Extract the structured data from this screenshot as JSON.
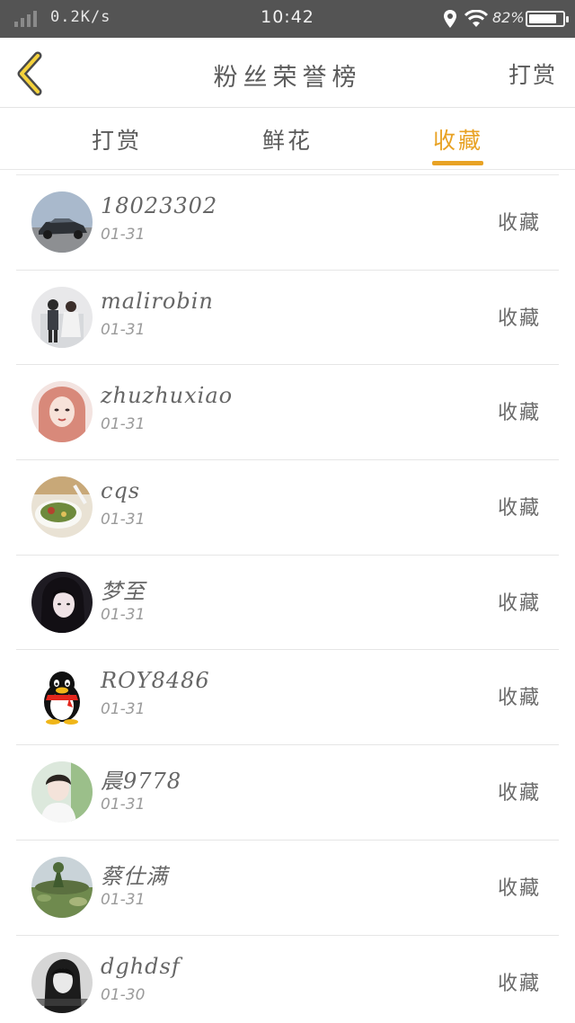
{
  "status_bar": {
    "network_speed": "0.2K/s",
    "time": "10:42",
    "battery_percent_label": "82%",
    "battery_level": 0.82
  },
  "header": {
    "title": "粉丝荣誉榜",
    "action_label": "打赏"
  },
  "tabs": [
    {
      "label": "打赏",
      "active": false
    },
    {
      "label": "鲜花",
      "active": false
    },
    {
      "label": "收藏",
      "active": true
    }
  ],
  "colors": {
    "accent": "#e8a224",
    "statusbar_bg": "#545454"
  },
  "list": [
    {
      "name": "18023302",
      "date": "01-31",
      "action": "收藏",
      "avatar_icon": "car-photo"
    },
    {
      "name": "malirobin",
      "date": "01-31",
      "action": "收藏",
      "avatar_icon": "couple-photo"
    },
    {
      "name": "zhuzhuxiao",
      "date": "01-31",
      "action": "收藏",
      "avatar_icon": "girl-selfie-photo"
    },
    {
      "name": "cqs",
      "date": "01-31",
      "action": "收藏",
      "avatar_icon": "food-bowl-photo"
    },
    {
      "name": "梦至",
      "date": "01-31",
      "action": "收藏",
      "avatar_icon": "dark-hair-girl-photo"
    },
    {
      "name": "ROY8486",
      "date": "01-31",
      "action": "收藏",
      "avatar_icon": "qq-penguin-icon"
    },
    {
      "name": "晨9778",
      "date": "01-31",
      "action": "收藏",
      "avatar_icon": "boy-portrait-photo"
    },
    {
      "name": "蔡仕满",
      "date": "01-31",
      "action": "收藏",
      "avatar_icon": "landscape-photo"
    },
    {
      "name": "dghdsf",
      "date": "01-30",
      "action": "收藏",
      "avatar_icon": "bw-portrait-photo"
    }
  ]
}
